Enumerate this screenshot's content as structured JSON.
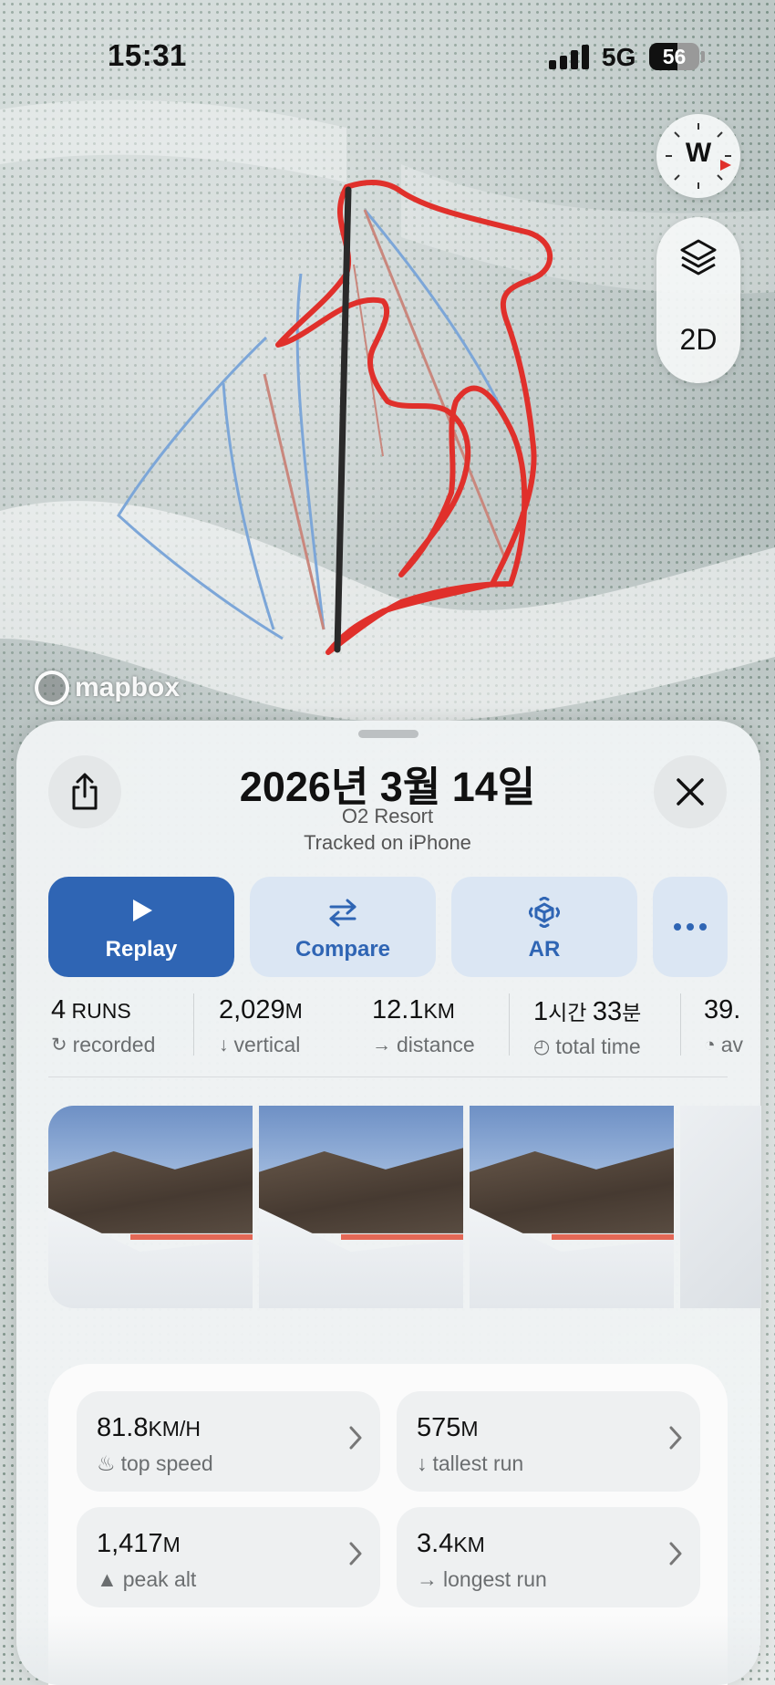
{
  "status_bar": {
    "time": "15:31",
    "network": "5G",
    "battery": "56",
    "battery_level": 0.56
  },
  "map": {
    "compass_heading": "W",
    "mode_toggle": "2D",
    "attribution": "mapbox",
    "colors": {
      "track": "#e0302b",
      "lift": "#2a2a2a",
      "piste_blue": "#7ca6d8",
      "piste_red": "#c9877d"
    }
  },
  "sheet": {
    "title": "2026년 3월 14일",
    "resort": "O2 Resort",
    "tracked_on": "Tracked on  iPhone",
    "actions": [
      {
        "label": "Replay",
        "icon": "play-icon"
      },
      {
        "label": "Compare",
        "icon": "compare-arrows-icon"
      },
      {
        "label": "AR",
        "icon": "ar-icon"
      },
      {
        "label": "",
        "icon": "more-icon"
      }
    ]
  },
  "summary": [
    {
      "value": "4",
      "unit": " RUNS",
      "label": "recorded",
      "icon": "refresh-icon"
    },
    {
      "value": "2,029",
      "unit": "M",
      "label": "vertical",
      "icon": "arrow-down-icon"
    },
    {
      "value": "12.1",
      "unit": "KM",
      "label": "distance",
      "icon": "arrow-right-icon"
    },
    {
      "value": "1",
      "unit": "시간 ",
      "value2": "33",
      "unit2": "분",
      "label": "total time",
      "icon": "timer-icon"
    },
    {
      "value": "39.",
      "unit": "",
      "label": "av",
      "icon": "gauge-icon"
    }
  ],
  "photos": [
    {
      "name": "photo-1"
    },
    {
      "name": "photo-2"
    },
    {
      "name": "photo-3"
    },
    {
      "name": "photo-4"
    }
  ],
  "metrics": [
    {
      "value": "81.8",
      "unit": "KM/H",
      "label": "top speed",
      "icon": "flame-icon"
    },
    {
      "value": "575",
      "unit": "M",
      "label": "tallest run",
      "icon": "arrow-down-icon"
    },
    {
      "value": "1,417",
      "unit": "M",
      "label": "peak alt",
      "icon": "mountain-icon"
    },
    {
      "value": "3.4",
      "unit": "KM",
      "label": "longest run",
      "icon": "arrow-right-icon"
    }
  ]
}
